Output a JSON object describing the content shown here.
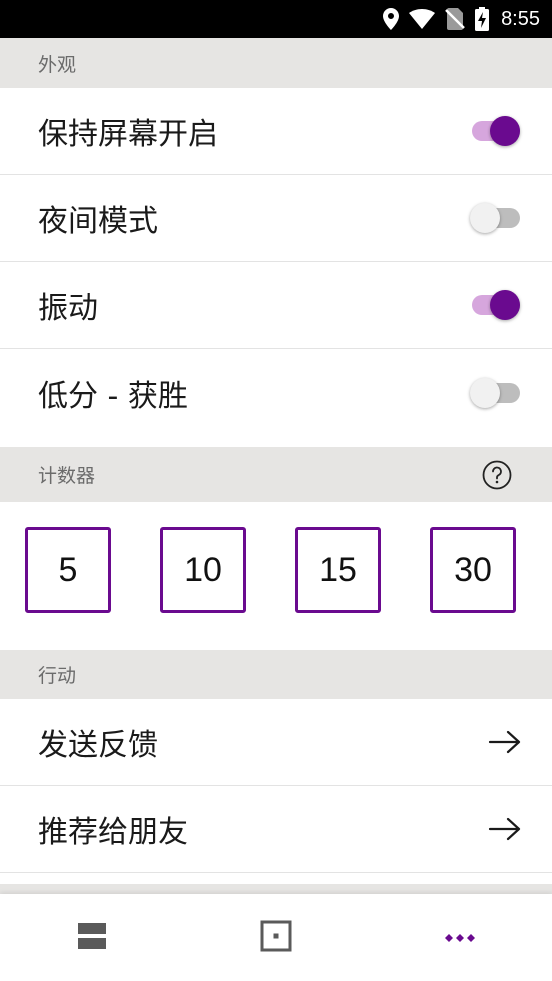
{
  "status_bar": {
    "time": "8:55",
    "icons": [
      "location-icon",
      "wifi-icon",
      "no-sim-icon",
      "battery-charging-icon"
    ]
  },
  "sections": {
    "appearance": {
      "title": "外观"
    },
    "counter": {
      "title": "计数器"
    },
    "actions": {
      "title": "行动"
    }
  },
  "settings": [
    {
      "label": "保持屏幕开启",
      "enabled": true
    },
    {
      "label": "夜间模式",
      "enabled": false
    },
    {
      "label": "振动",
      "enabled": true
    },
    {
      "label": "低分 - 获胜",
      "enabled": false
    }
  ],
  "counter_values": [
    "5",
    "10",
    "15",
    "30"
  ],
  "actions": [
    {
      "label": "发送反馈"
    },
    {
      "label": "推荐给朋友"
    }
  ],
  "bottom_nav": {
    "items": [
      "list-icon",
      "board-icon",
      "more-icon"
    ],
    "active": "more-icon"
  },
  "colors": {
    "accent": "#6a0a8f",
    "accent_track": "#d6a6dd",
    "section_bg": "#e6e5e3",
    "status_bar_bg": "#000000"
  }
}
